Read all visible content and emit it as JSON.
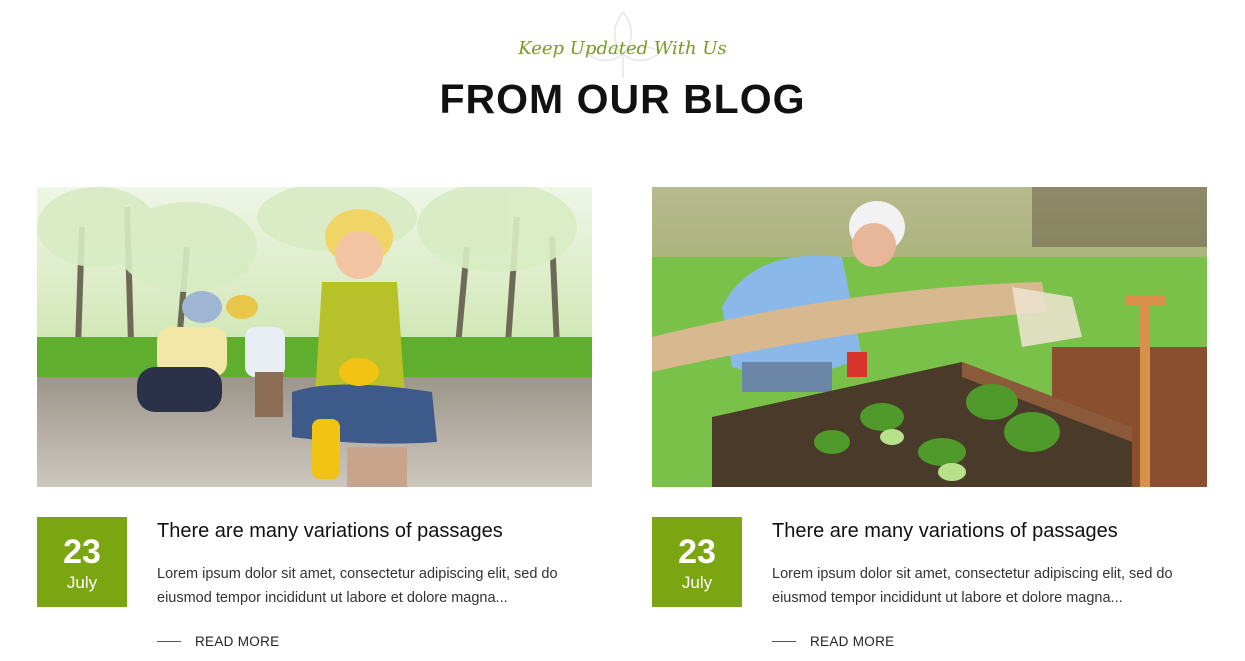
{
  "section": {
    "subtitle": "Keep Updated With Us",
    "title": "FROM OUR BLOG",
    "decor_icon": "leaf-outline-icon",
    "accent_color": "#7ba511"
  },
  "posts": [
    {
      "image_alt": "woman and child gardening in an orchard",
      "day": "23",
      "month": "July",
      "title": "There are many variations of passages",
      "excerpt": "Lorem ipsum dolor sit amet, consectetur adipiscing elit, sed do eiusmod tempor incididunt ut labore et dolore magna...",
      "read_more": "READ MORE"
    },
    {
      "image_alt": "elderly man tending a raised garden bed",
      "day": "23",
      "month": "July",
      "title": "There are many variations of passages",
      "excerpt": "Lorem ipsum dolor sit amet, consectetur adipiscing elit, sed do eiusmod tempor incididunt ut labore et dolore magna...",
      "read_more": "READ MORE"
    }
  ]
}
